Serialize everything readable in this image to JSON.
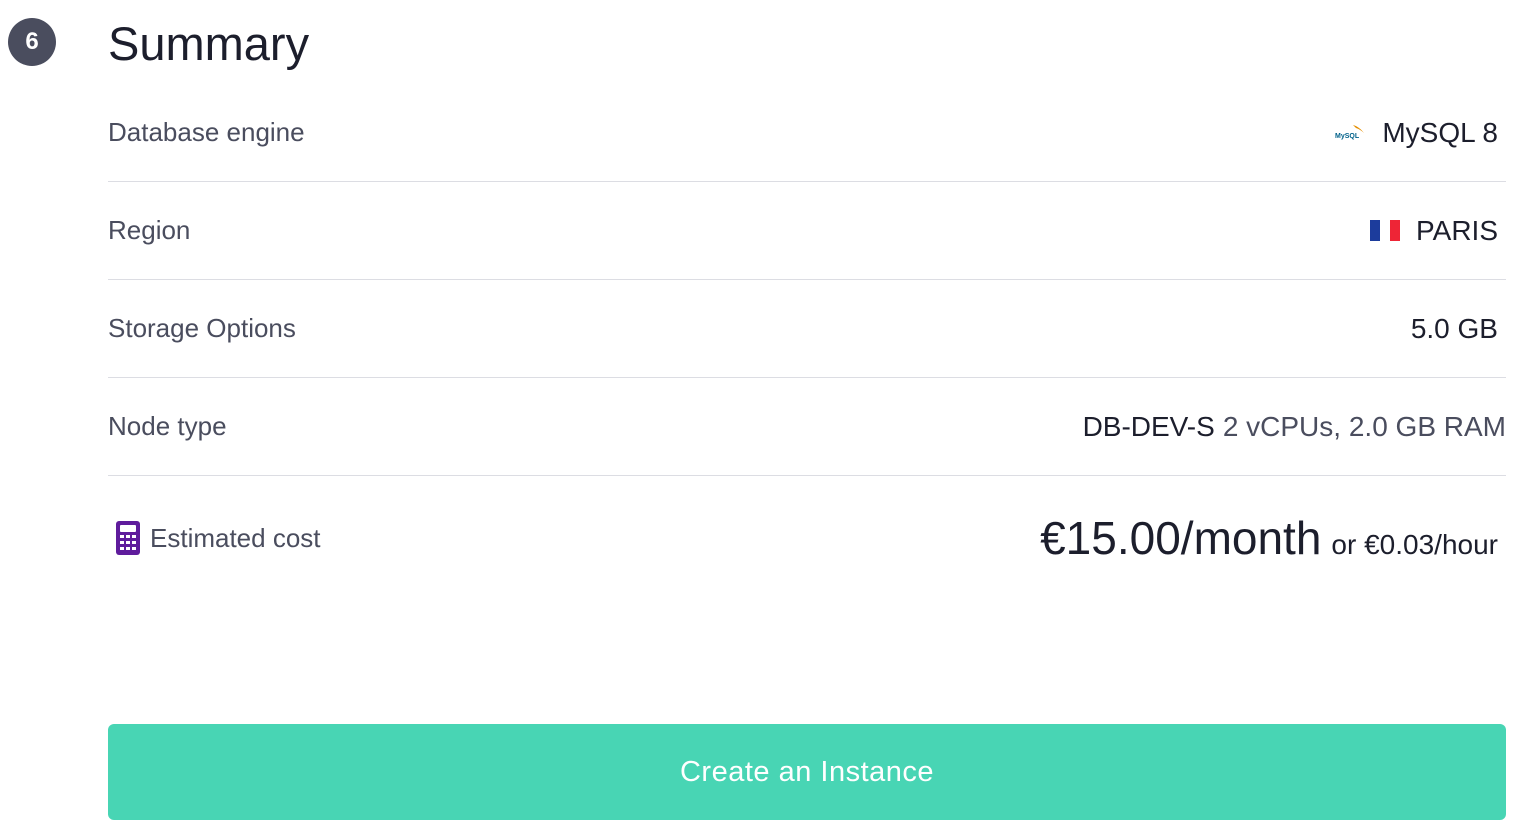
{
  "step": {
    "number": "6",
    "title": "Summary"
  },
  "summary": {
    "database_engine": {
      "label": "Database engine",
      "value": "MySQL 8",
      "icon": "mysql-logo-icon",
      "logo_text": "MySQL"
    },
    "region": {
      "label": "Region",
      "value": "PARIS",
      "icon": "france-flag-icon"
    },
    "storage": {
      "label": "Storage Options",
      "value": "5.0 GB"
    },
    "node_type": {
      "label": "Node type",
      "code": "DB-DEV-S",
      "specs": "2 vCPUs, 2.0 GB RAM"
    },
    "estimated_cost": {
      "label": "Estimated cost",
      "icon": "calculator-icon",
      "monthly": "€15.00/month",
      "hourly": "or €0.03/hour"
    }
  },
  "actions": {
    "create_label": "Create an Instance"
  },
  "colors": {
    "badge": "#4a4d5e",
    "accent_button": "#48d5b4",
    "calculator_icon": "#5f1c9c",
    "divider": "#dcdde3"
  }
}
